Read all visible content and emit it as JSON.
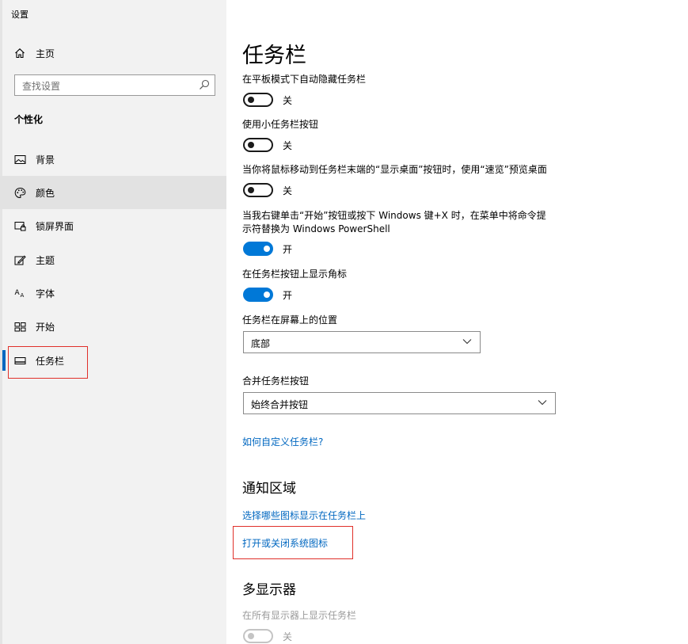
{
  "window": {
    "title": "设置"
  },
  "sidebar": {
    "home_label": "主页",
    "search_placeholder": "查找设置",
    "section_heading": "个性化",
    "items": [
      {
        "label": "背景",
        "icon": "picture-icon"
      },
      {
        "label": "颜色",
        "icon": "palette-icon"
      },
      {
        "label": "锁屏界面",
        "icon": "lock-screen-icon"
      },
      {
        "label": "主题",
        "icon": "theme-icon"
      },
      {
        "label": "字体",
        "icon": "font-icon"
      },
      {
        "label": "开始",
        "icon": "start-icon"
      },
      {
        "label": "任务栏",
        "icon": "taskbar-icon"
      }
    ],
    "selected_index": 6,
    "hover_index": 1
  },
  "main": {
    "title": "任务栏",
    "settings": [
      {
        "label": "在平板模式下自动隐藏任务栏",
        "state": "关",
        "on": false
      },
      {
        "label": "使用小任务栏按钮",
        "state": "关",
        "on": false
      },
      {
        "label": "当你将鼠标移动到任务栏末端的“显示桌面”按钮时，使用“速览”预览桌面",
        "state": "关",
        "on": false
      },
      {
        "label_line1": "当我右键单击“开始”按钮或按下 Windows 键+X 时，在菜单中将命令提",
        "label_line2": "示符替换为 Windows PowerShell",
        "state": "开",
        "on": true
      },
      {
        "label": "在任务栏按钮上显示角标",
        "state": "开",
        "on": true
      }
    ],
    "position": {
      "label": "任务栏在屏幕上的位置",
      "value": "底部"
    },
    "combine": {
      "label": "合并任务栏按钮",
      "value": "始终合并按钮"
    },
    "help_link": "如何自定义任务栏?",
    "notification": {
      "heading": "通知区域",
      "link1": "选择哪些图标显示在任务栏上",
      "link2": "打开或关闭系统图标"
    },
    "multi_display": {
      "heading": "多显示器",
      "label": "在所有显示器上显示任务栏",
      "state": "关",
      "on": false,
      "disabled": true
    }
  },
  "colors": {
    "accent": "#0078d7",
    "link": "#0067c0",
    "highlight_box": "#e0302a"
  }
}
